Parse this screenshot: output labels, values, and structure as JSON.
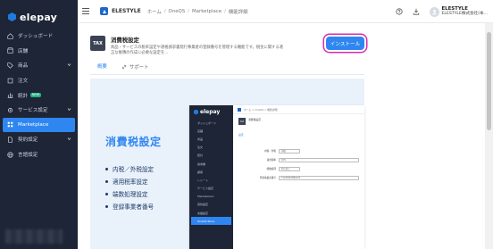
{
  "sidebar": {
    "logo": "elepay",
    "items": [
      {
        "label": "ダッシュボード",
        "icon": "home-icon",
        "has_children": false,
        "active": false
      },
      {
        "label": "店舗",
        "icon": "store-icon",
        "has_children": false,
        "active": false
      },
      {
        "label": "商品",
        "icon": "tag-icon",
        "has_children": true,
        "active": false
      },
      {
        "label": "注文",
        "icon": "cart-icon",
        "has_children": false,
        "active": false
      },
      {
        "label": "統計",
        "icon": "chart-icon",
        "has_children": false,
        "active": false,
        "badge": "NEW"
      },
      {
        "label": "サービス設定",
        "icon": "gear-icon",
        "has_children": true,
        "active": false
      },
      {
        "label": "Marketplace",
        "icon": "grid-icon",
        "has_children": false,
        "active": true
      },
      {
        "label": "契約設定",
        "icon": "document-icon",
        "has_children": true,
        "active": false
      },
      {
        "label": "言語設定",
        "icon": "globe-icon",
        "has_children": false,
        "active": false
      }
    ]
  },
  "header": {
    "brand": "ELESTYLE",
    "breadcrumb": [
      "ホーム",
      "OneQS",
      "Marketplace",
      "機能詳細"
    ],
    "user_name": "ELESTYLE",
    "user_company": "ELESTYLE株式会社(本..."
  },
  "app": {
    "icon_label": "TAX",
    "title": "消費税設定",
    "description": "商品・サービスの税率設定や適格請求書発行事業者の登録番号を管理する機能です。税金に関する適正な帳簿の作成に必要な設定を一元的に行えます。",
    "description_display": "商品・サービスの税率設定や適格請求書発行事業者の登録番号を管理する機能です。税金に関する適\n正な帳簿の作成に必要な設定を...",
    "install_label": "インストール"
  },
  "tabs": [
    {
      "label": "概要",
      "active": true
    },
    {
      "label": "サポート",
      "active": false
    }
  ],
  "hero": {
    "title": "消費税設定",
    "bullets": [
      "内税／外税設定",
      "適用税率設定",
      "端数処理設定",
      "登録事業者番号"
    ]
  },
  "preview": {
    "logo": "elepay",
    "nav": [
      "ダッシュボード",
      "店舗",
      "商品",
      "注文",
      "統計",
      "請求書",
      "顧客",
      "レシート",
      "サービス設定",
      "Marketplace",
      "契約設定",
      "言語設定",
      "OneQS Store"
    ],
    "breadcrumb": "ホーム > OneQS > 機能詳細",
    "app_title": "消費税設定",
    "tab": "設定",
    "fields": [
      {
        "label": "内税／外税",
        "value": "内税"
      },
      {
        "label": "適用税率",
        "value": "10%"
      },
      {
        "label": "端数処理",
        "value": "切り捨て"
      },
      {
        "label": "登録事業者番号",
        "value": "T1234567890123"
      }
    ]
  },
  "colors": {
    "accent": "#2f86f0",
    "sidebar_bg": "#1d2536",
    "highlight": "#d92bb0"
  }
}
